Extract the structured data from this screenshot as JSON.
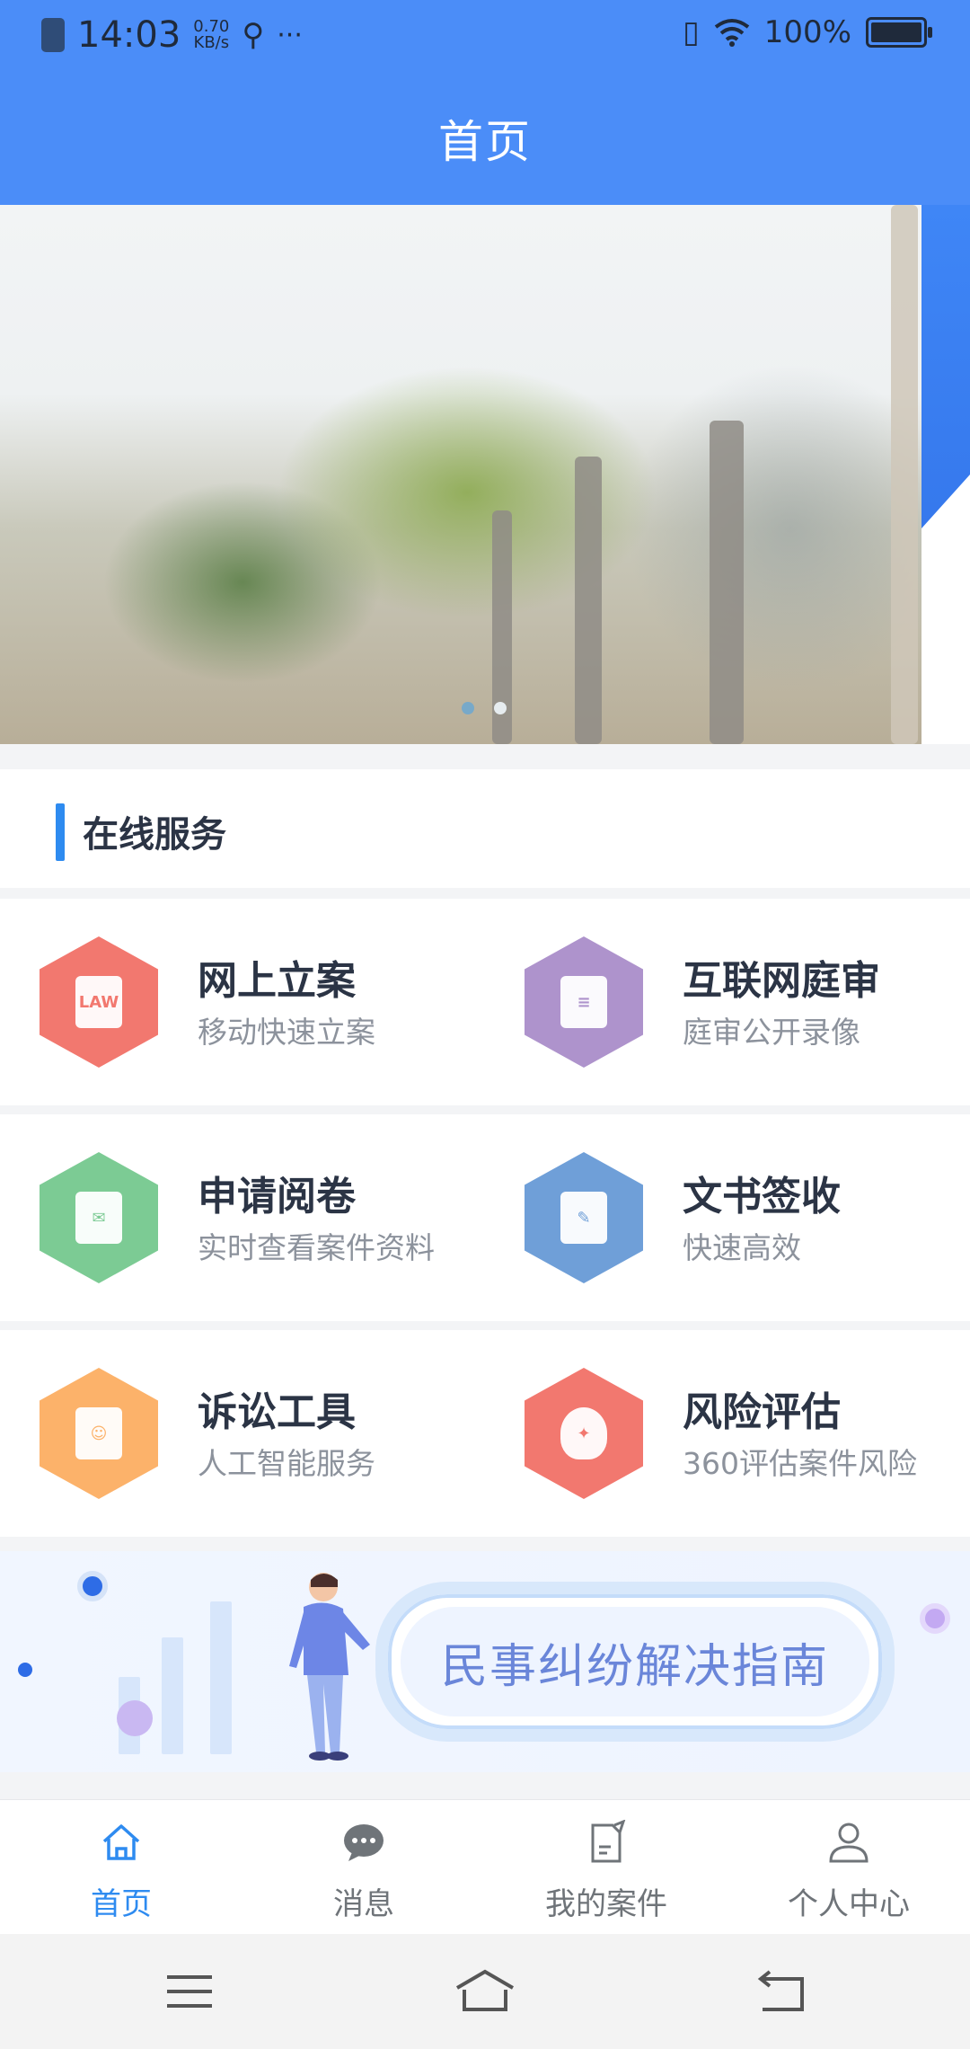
{
  "status_bar": {
    "time": "14:03",
    "speed_value": "0.70",
    "speed_unit": "KB/s",
    "more": "···",
    "battery": "100%"
  },
  "header": {
    "title": "首页"
  },
  "banner": {
    "pages": 2,
    "active_page": 1
  },
  "online_service": {
    "title": "在线服务",
    "items": [
      {
        "title": "网上立案",
        "subtitle": "移动快速立案",
        "icon": "law-document-icon",
        "color": "#f2786f"
      },
      {
        "title": "互联网庭审",
        "subtitle": "庭审公开录像",
        "icon": "list-document-icon",
        "color": "#ae93cc"
      },
      {
        "title": "申请阅卷",
        "subtitle": "实时查看案件资料",
        "icon": "envelope-icon",
        "color": "#7ccb94"
      },
      {
        "title": "文书签收",
        "subtitle": "快速高效",
        "icon": "edit-document-icon",
        "color": "#6f9fd8"
      },
      {
        "title": "诉讼工具",
        "subtitle": "人工智能服务",
        "icon": "person-tool-icon",
        "color": "#fcb26a"
      },
      {
        "title": "风险评估",
        "subtitle": "360评估案件风险",
        "icon": "money-bag-icon",
        "color": "#f2786f"
      }
    ]
  },
  "guide_banner": {
    "text": "民事纠纷解决指南"
  },
  "bottom_nav": [
    {
      "label": "首页",
      "icon": "home-icon",
      "active": true
    },
    {
      "label": "消息",
      "icon": "message-icon",
      "active": false
    },
    {
      "label": "我的案件",
      "icon": "case-document-icon",
      "active": false
    },
    {
      "label": "个人中心",
      "icon": "person-icon",
      "active": false
    }
  ],
  "colors": {
    "primary": "#4b8df8",
    "accent": "#2e8bf0"
  }
}
